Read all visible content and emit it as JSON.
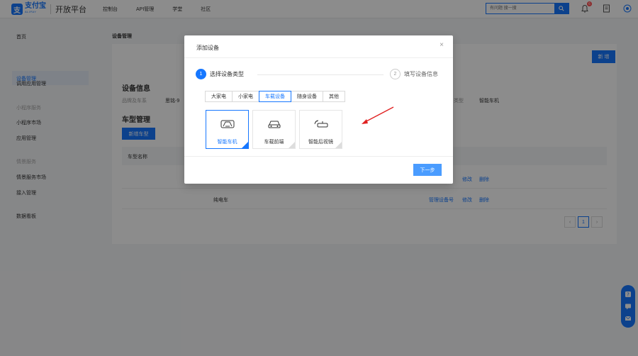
{
  "brand": {
    "logo_glyph": "支",
    "logo_cn": "支付宝",
    "logo_en": "ALIPAY",
    "product": "开放平台",
    "color": "#1677ff"
  },
  "nav": {
    "items": [
      "控制台",
      "API管理",
      "学堂",
      "社区"
    ]
  },
  "search": {
    "placeholder": "有问题 搜一搜"
  },
  "header_icons": {
    "notification_count": "6"
  },
  "sidebar": {
    "home": "首页",
    "device_mgmt": "设备管理",
    "app_call": "调用应用管理",
    "group_mini": "小程序服务",
    "mini_market": "小程序市场",
    "app_mgmt": "应用管理",
    "group_scene": "情景服务",
    "scene_market": "情景服务市场",
    "access_mgmt": "接入管理",
    "dashboard": "数据看板"
  },
  "page": {
    "title": "设备管理",
    "new_button": "新 增",
    "info_title": "设备信息",
    "brand_label": "品牌及车系",
    "brand_value": "思铭-9",
    "type_label": "类型",
    "type_value": "智能车机",
    "models_title": "车型管理",
    "add_model_button": "新增车型",
    "table_header": "车型名称",
    "rows": [
      {
        "name": "",
        "actions": [
          "修改",
          "删除"
        ]
      },
      {
        "name": "纯电车",
        "manage": "管理设备号",
        "actions": [
          "修改",
          "删除"
        ]
      }
    ],
    "pager_current": "1"
  },
  "modal": {
    "title": "添加设备",
    "close": "×",
    "steps": [
      {
        "num": "1",
        "label": "选择设备类型"
      },
      {
        "num": "2",
        "label": "填写设备信息"
      }
    ],
    "tabs": [
      "大家电",
      "小家电",
      "车载设备",
      "随身设备",
      "其他"
    ],
    "active_tab": "车载设备",
    "cards": [
      {
        "label": "智能车机",
        "selected": true
      },
      {
        "label": "车载前端",
        "selected": false
      },
      {
        "label": "智能后视镜",
        "selected": false
      }
    ],
    "next_button": "下一步"
  }
}
